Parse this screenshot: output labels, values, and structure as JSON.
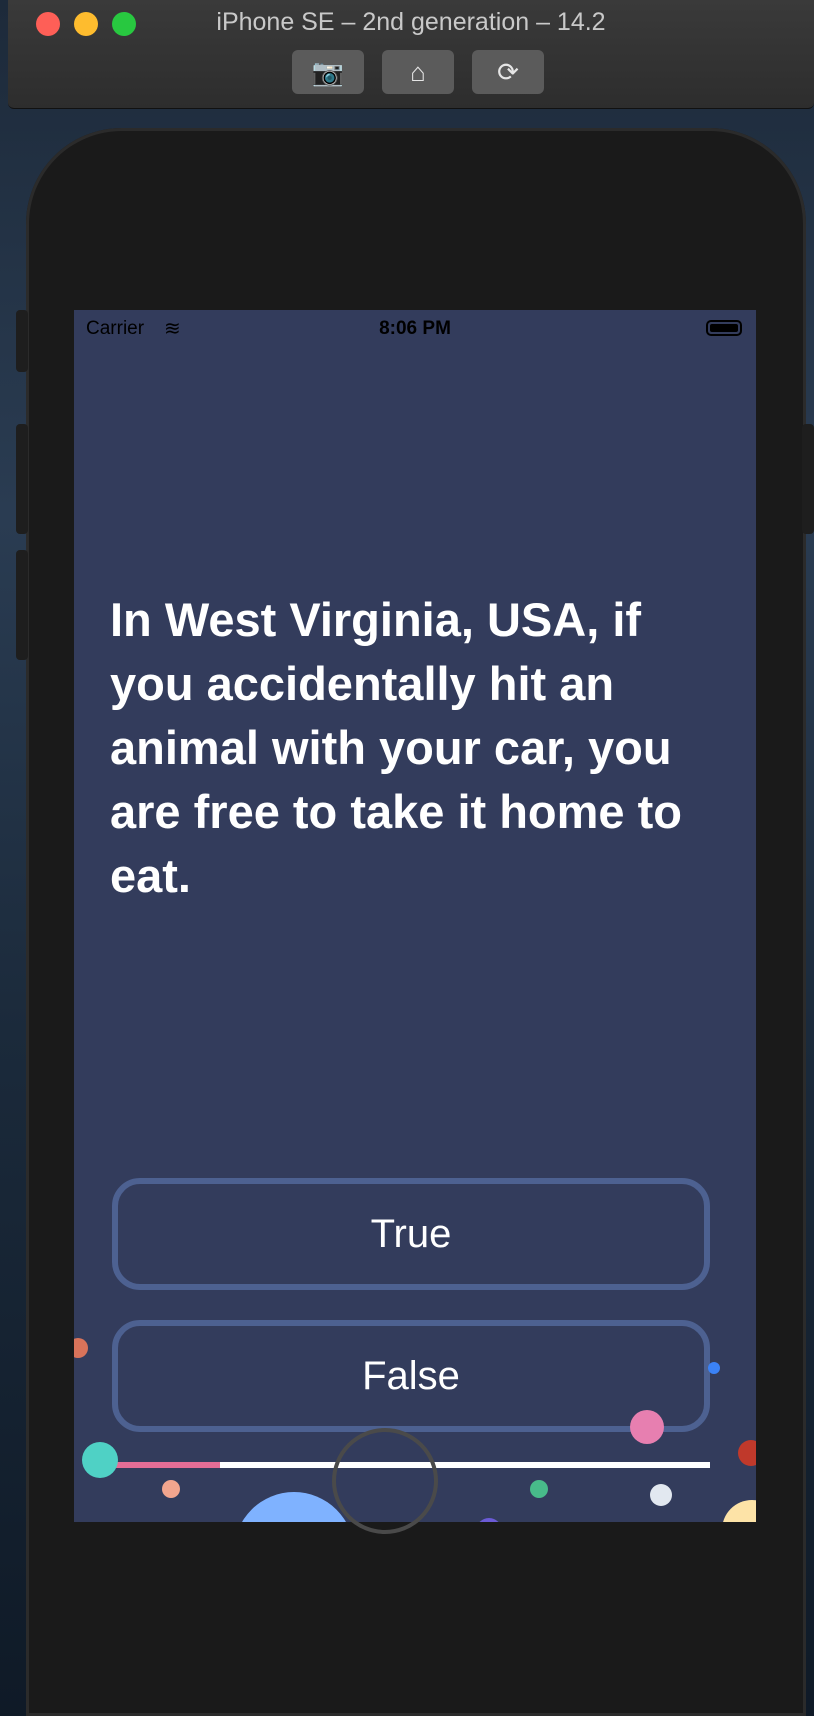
{
  "window": {
    "title": "iPhone SE – 2nd generation – 14.2",
    "toolbar": [
      {
        "icon": "camera-icon",
        "glyph": "📷"
      },
      {
        "icon": "home-icon",
        "glyph": "⌂"
      },
      {
        "icon": "rotate-icon",
        "glyph": "⟳"
      }
    ]
  },
  "status_bar": {
    "carrier": "Carrier",
    "wifi_glyph": "≋",
    "time": "8:06 PM"
  },
  "quiz": {
    "question": "In West Virginia, USA, if you accidentally hit an animal with your car, you are free to take it home to eat.",
    "answers": [
      "True",
      "False"
    ],
    "progress": 0.18
  },
  "colors": {
    "background": "#333c5c",
    "button_border": "#4d6191",
    "progress_fill": "#e56d96",
    "progress_track": "#ffffff"
  }
}
